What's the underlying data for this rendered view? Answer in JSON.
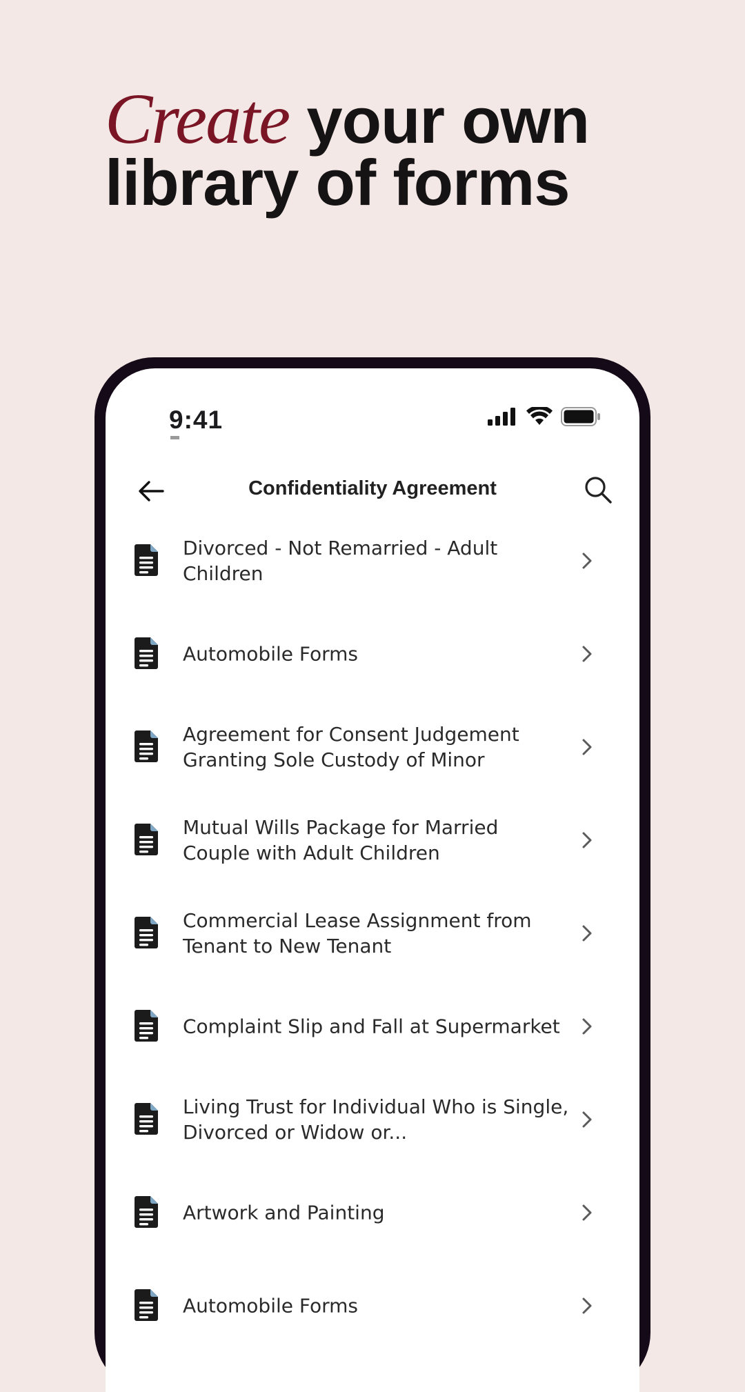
{
  "headline": {
    "accent_word": "Create",
    "line1_rest": " your own",
    "line2": "library of forms"
  },
  "colors": {
    "background": "#f3e8e5",
    "accent": "#7a1526",
    "phone_frame": "#150a18"
  },
  "status_bar": {
    "time": "9:41",
    "icons": [
      "signal-icon",
      "wifi-icon",
      "battery-icon"
    ]
  },
  "nav": {
    "title": "Confidentiality Agreement",
    "back_icon": "arrow-left-icon",
    "search_icon": "search-icon"
  },
  "list": {
    "items": [
      {
        "label": "Divorced - Not Remarried - Adult Children"
      },
      {
        "label": "Automobile Forms"
      },
      {
        "label": "Agreement for Consent Judgement Granting Sole Custody of Minor"
      },
      {
        "label": "Mutual Wills Package for Married Couple with Adult Children"
      },
      {
        "label": "Commercial Lease Assignment from Tenant to New Tenant"
      },
      {
        "label": "Complaint Slip and Fall at Supermarket"
      },
      {
        "label": "Living Trust for Individual Who is Single, Divorced or Widow or..."
      },
      {
        "label": "Artwork and Painting"
      },
      {
        "label": "Automobile Forms"
      }
    ]
  }
}
